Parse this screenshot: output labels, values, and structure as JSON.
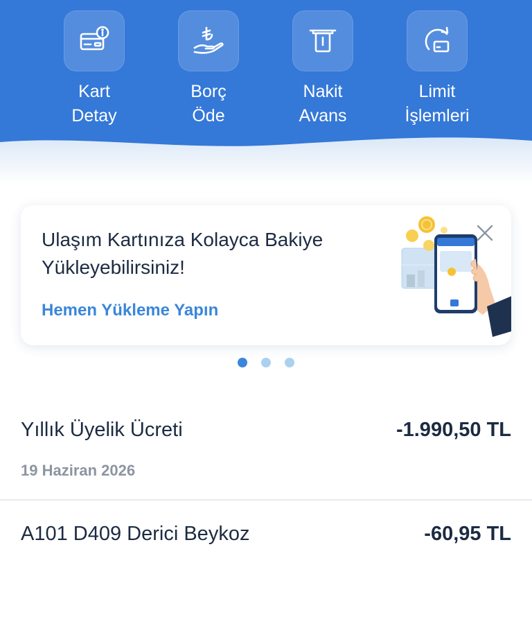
{
  "quick_actions": [
    {
      "line1": "Kart",
      "line2": "Detay",
      "icon": "card-info-icon"
    },
    {
      "line1": "Borç",
      "line2": "Öde",
      "icon": "lira-hand-icon"
    },
    {
      "line1": "Nakit",
      "line2": "Avans",
      "icon": "cash-withdraw-icon"
    },
    {
      "line1": "Limit",
      "line2": "İşlemleri",
      "icon": "limit-card-icon"
    }
  ],
  "promo": {
    "line1": "Ulaşım Kartınıza Kolayca Bakiye",
    "line2": "Yükleyebilirsiniz!",
    "link": "Hemen Yükleme Yapın",
    "close_icon": "close-icon",
    "illustration": "phone-with-coins-illustration"
  },
  "pager": {
    "total": 3,
    "active": 1
  },
  "transactions": [
    {
      "title": "Yıllık Üyelik Ücreti",
      "amount": "-1.990,50 TL",
      "date": "19 Haziran 2026"
    },
    {
      "title": "A101 D409 Derici Beykoz",
      "amount": "-60,95 TL"
    }
  ],
  "colors": {
    "header": "#3478d8",
    "accent": "#3a86da",
    "text": "#1c2b41",
    "muted": "#8c959f"
  }
}
